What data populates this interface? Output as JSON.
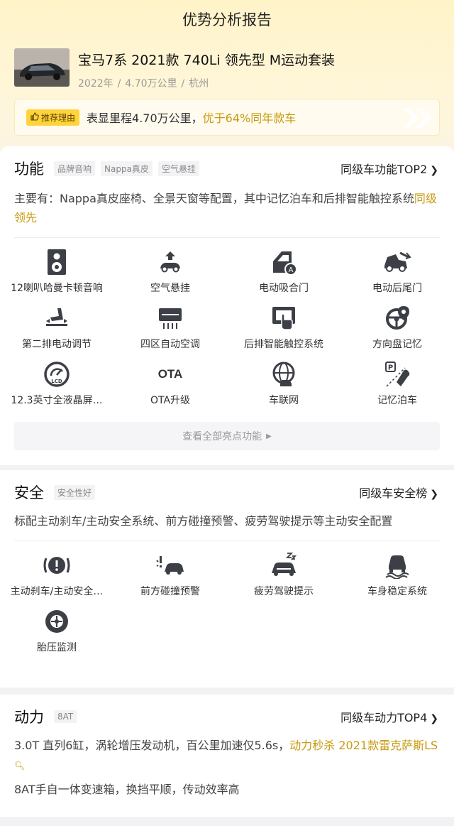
{
  "page_title": "优势分析报告",
  "car": {
    "name": "宝马7系 2021款 740Li 领先型 M运动套装",
    "year": "2022年",
    "mileage": "4.70万公里",
    "city": "杭州",
    "meta_sep": "/"
  },
  "reason": {
    "badge": "推荐理由",
    "text_prefix": "表显里程4.70万公里，",
    "text_highlight": "优于64%同年款车"
  },
  "features": {
    "title": "功能",
    "tags": [
      "品牌音响",
      "Nappa真皮",
      "空气悬挂"
    ],
    "link": "同级车功能TOP2",
    "desc_prefix": "主要有：Nappa真皮座椅、全景天窗等配置，其中记忆泊车和后排智能触控系统",
    "desc_highlight": "同级领先",
    "items": [
      {
        "label": "12喇叭哈曼卡顿音响",
        "icon": "speaker-icon"
      },
      {
        "label": "空气悬挂",
        "icon": "air-suspension-icon"
      },
      {
        "label": "电动吸合门",
        "icon": "soft-close-door-icon"
      },
      {
        "label": "电动后尾门",
        "icon": "power-tailgate-icon"
      },
      {
        "label": "第二排电动调节",
        "icon": "power-seat-icon"
      },
      {
        "label": "四区自动空调",
        "icon": "air-conditioner-icon"
      },
      {
        "label": "后排智能触控系统",
        "icon": "touch-control-icon"
      },
      {
        "label": "方向盘记忆",
        "icon": "steering-memory-icon"
      },
      {
        "label": "12.3英寸全液晶屏…",
        "icon": "lcd-gauge-icon"
      },
      {
        "label": "OTA升级",
        "icon": "ota-icon",
        "text": "OTA"
      },
      {
        "label": "车联网",
        "icon": "connected-car-icon"
      },
      {
        "label": "记忆泊车",
        "icon": "memory-parking-icon"
      }
    ],
    "more": "查看全部亮点功能"
  },
  "safety": {
    "title": "安全",
    "tags": [
      "安全性好"
    ],
    "link": "同级车安全榜",
    "desc": "标配主动刹车/主动安全系统、前方碰撞预警、疲劳驾驶提示等主动安全配置",
    "items": [
      {
        "label": "主动刹车/主动安全…",
        "icon": "brake-warning-icon"
      },
      {
        "label": "前方碰撞预警",
        "icon": "collision-warning-icon"
      },
      {
        "label": "疲劳驾驶提示",
        "icon": "fatigue-icon"
      },
      {
        "label": "车身稳定系统",
        "icon": "stability-icon"
      },
      {
        "label": "胎压监测",
        "icon": "tire-pressure-icon"
      }
    ]
  },
  "power": {
    "title": "动力",
    "tags": [
      "8AT"
    ],
    "link": "同级车动力TOP4",
    "desc_prefix": "3.0T 直列6缸，涡轮增压发动机，百公里加速仅5.6s，",
    "desc_highlight": "动力秒杀 2021款雷克萨斯LS",
    "desc2": "8AT手自一体变速箱，换挡平顺，传动效率高"
  },
  "colors": {
    "accent": "#c89a10",
    "badge": "#ffd43b"
  }
}
